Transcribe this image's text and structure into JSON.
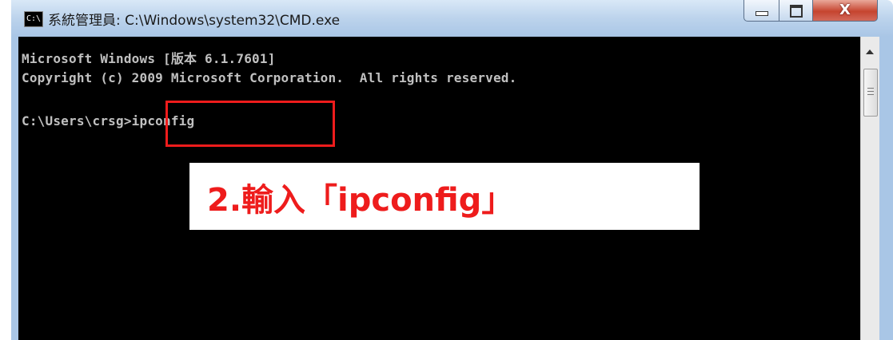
{
  "window": {
    "title": "系統管理員: C:\\Windows\\system32\\CMD.exe",
    "icon_text": "C:\\",
    "controls": {
      "minimize": "minimize",
      "maximize": "maximize",
      "close": "X"
    }
  },
  "console": {
    "lines": [
      "Microsoft Windows [版本 6.1.7601]",
      "Copyright (c) 2009 Microsoft Corporation.  All rights reserved.",
      "",
      "C:\\Users\\crsg>ipconfig"
    ]
  },
  "annotation": {
    "text": "2.輸入「ipconfig」",
    "color": "#ee1c1c"
  },
  "colors": {
    "console_bg": "#000000",
    "console_text": "#c0c0c0",
    "highlight": "#ee1c1c",
    "frame": "#a9c6e6"
  }
}
